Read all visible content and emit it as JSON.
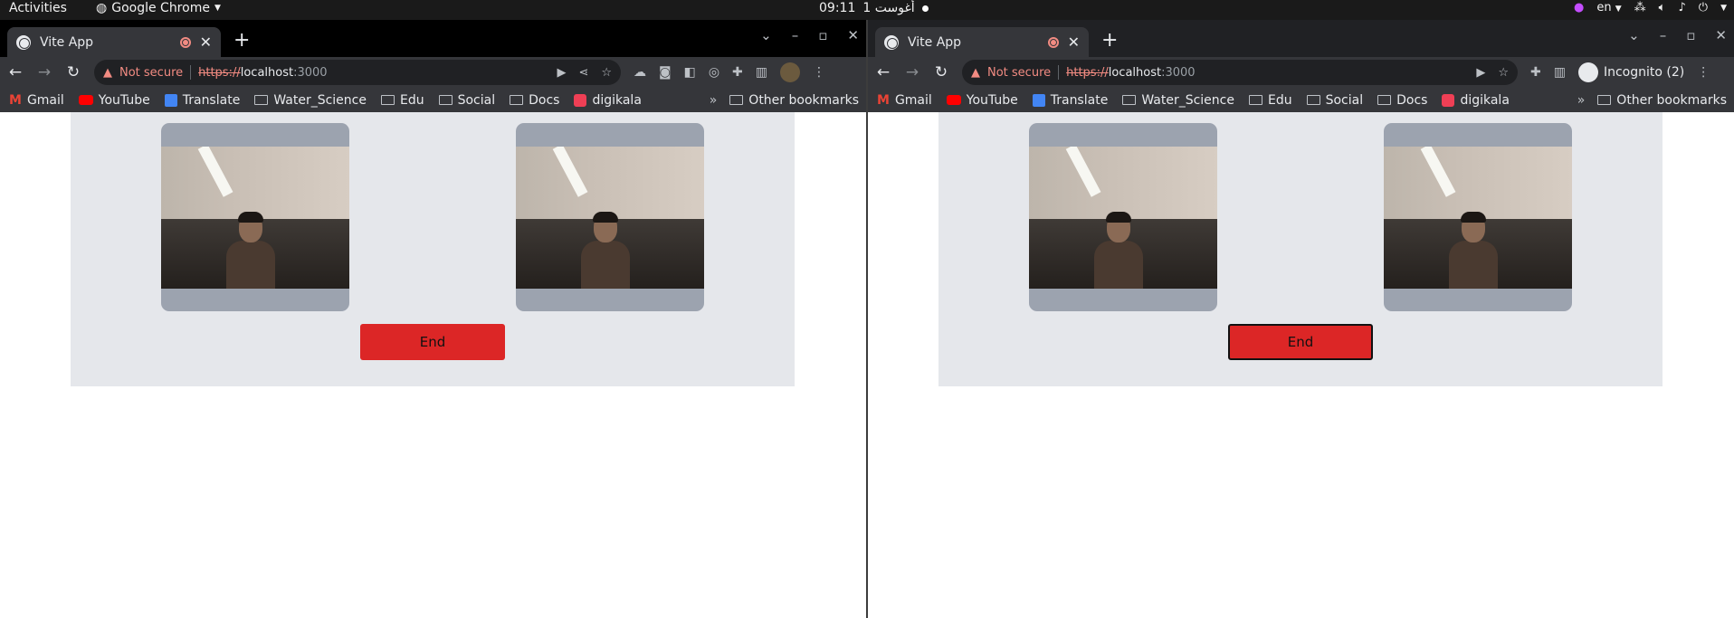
{
  "topbar": {
    "activities": "Activities",
    "app_name": "Google Chrome",
    "clock": "09:11",
    "date": "أغوست 1",
    "lang": "en"
  },
  "windows": [
    {
      "id": "left",
      "tab_title": "Vite App",
      "omnibox": {
        "security": "Not secure",
        "scheme": "https://",
        "host": "localhost",
        "port": ":3000"
      },
      "bookmarks": [
        "Gmail",
        "YouTube",
        "Translate",
        "Water_Science",
        "Edu",
        "Social",
        "Docs",
        "digikala"
      ],
      "other_bookmarks": "Other bookmarks",
      "end_label": "End"
    },
    {
      "id": "right",
      "tab_title": "Vite App",
      "omnibox": {
        "security": "Not secure",
        "scheme": "https://",
        "host": "localhost",
        "port": ":3000"
      },
      "incognito": "Incognito (2)",
      "bookmarks": [
        "Gmail",
        "YouTube",
        "Translate",
        "Water_Science",
        "Edu",
        "Social",
        "Docs",
        "digikala"
      ],
      "other_bookmarks": "Other bookmarks",
      "end_label": "End"
    }
  ],
  "colors": {
    "end_button": "#dc2626",
    "panel": "#e5e7eb",
    "video_tile": "#9ca3af"
  }
}
